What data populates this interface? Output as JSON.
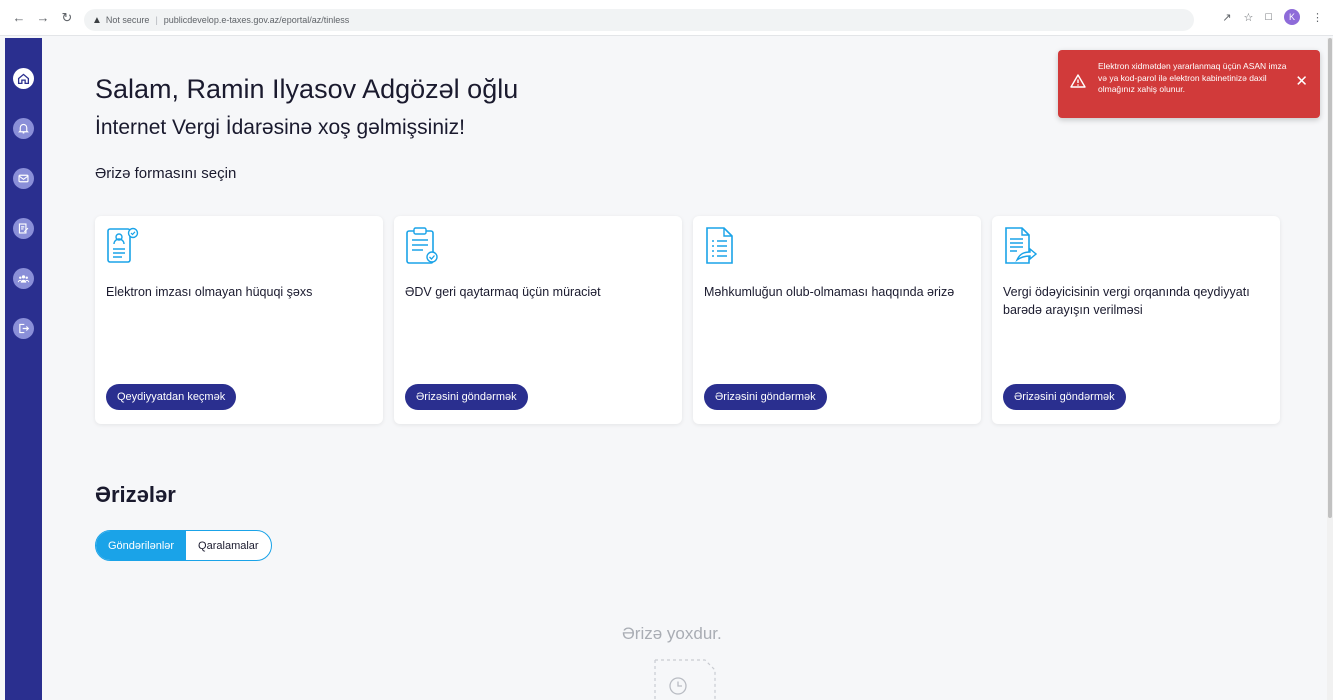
{
  "browser": {
    "security_label": "Not secure",
    "url": "publicdevelop.e-taxes.gov.az/eportal/az/tinless",
    "profile_initial": "K"
  },
  "sidebar": {
    "items": [
      {
        "icon": "home-icon",
        "active": true
      },
      {
        "icon": "bell-icon",
        "active": false
      },
      {
        "icon": "mail-icon",
        "active": false
      },
      {
        "icon": "edit-document-icon",
        "active": false
      },
      {
        "icon": "users-icon",
        "active": false
      },
      {
        "icon": "logout-icon",
        "active": false
      }
    ]
  },
  "header": {
    "greeting": "Salam, Ramin Ilyasov Adgözəl oğlu",
    "welcome": "İnternet Vergi İdarəsinə xoş gəlmişsiniz!",
    "choose_form": "Ərizə formasını seçin"
  },
  "cards": [
    {
      "icon": "id-badge-document-icon",
      "title": "Elektron imzası olmayan hüquqi şəxs",
      "button": "Qeydiyyatdan keçmək"
    },
    {
      "icon": "clipboard-check-icon",
      "title": "ƏDV geri qaytarmaq üçün müraciət",
      "button": "Ərizəsini göndərmək"
    },
    {
      "icon": "list-document-icon",
      "title": "Məhkumluğun olub-olmaması haqqında ərizə",
      "button": "Ərizəsini göndərmək"
    },
    {
      "icon": "document-share-icon",
      "title": "Vergi ödəyicisinin vergi orqanında qeydiyyatı barədə arayışın verilməsi",
      "button": "Ərizəsini göndərmək"
    }
  ],
  "applications": {
    "title": "Ərizələr",
    "tabs": [
      "Göndərilənlər",
      "Qaralamalar"
    ],
    "active_tab": 0,
    "empty_text": "Ərizə yoxdur."
  },
  "toast": {
    "message": "Elektron xidmətdən yararlanmaq üçün ASAN imza və ya kod-parol ilə elektron kabinetinizə daxil olmağınız xahiş olunur.",
    "color": "#d13a3a"
  },
  "colors": {
    "primary": "#2a2f8f",
    "accent": "#1aa3e8"
  }
}
